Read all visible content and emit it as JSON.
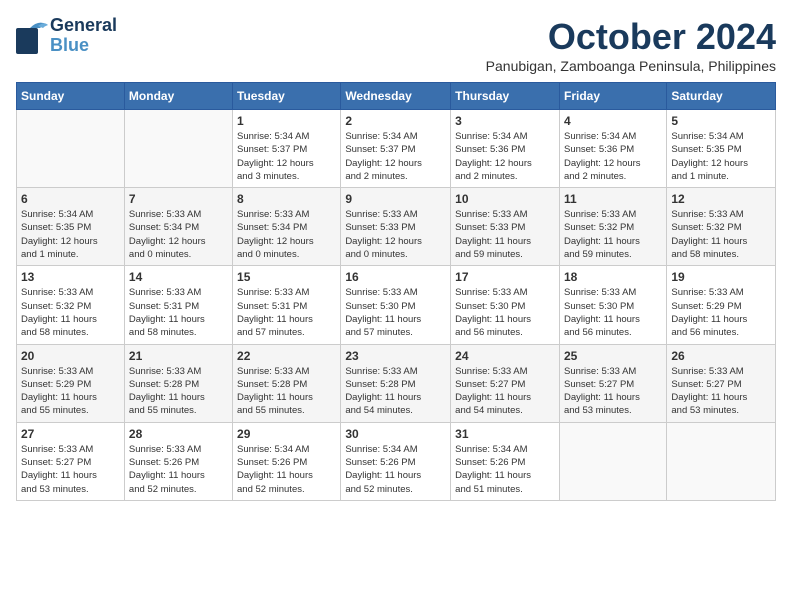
{
  "logo": {
    "general": "General",
    "blue": "Blue"
  },
  "title": "October 2024",
  "location": "Panubigan, Zamboanga Peninsula, Philippines",
  "days_header": [
    "Sunday",
    "Monday",
    "Tuesday",
    "Wednesday",
    "Thursday",
    "Friday",
    "Saturday"
  ],
  "weeks": [
    [
      {
        "day": "",
        "info": ""
      },
      {
        "day": "",
        "info": ""
      },
      {
        "day": "1",
        "info": "Sunrise: 5:34 AM\nSunset: 5:37 PM\nDaylight: 12 hours\nand 3 minutes."
      },
      {
        "day": "2",
        "info": "Sunrise: 5:34 AM\nSunset: 5:37 PM\nDaylight: 12 hours\nand 2 minutes."
      },
      {
        "day": "3",
        "info": "Sunrise: 5:34 AM\nSunset: 5:36 PM\nDaylight: 12 hours\nand 2 minutes."
      },
      {
        "day": "4",
        "info": "Sunrise: 5:34 AM\nSunset: 5:36 PM\nDaylight: 12 hours\nand 2 minutes."
      },
      {
        "day": "5",
        "info": "Sunrise: 5:34 AM\nSunset: 5:35 PM\nDaylight: 12 hours\nand 1 minute."
      }
    ],
    [
      {
        "day": "6",
        "info": "Sunrise: 5:34 AM\nSunset: 5:35 PM\nDaylight: 12 hours\nand 1 minute."
      },
      {
        "day": "7",
        "info": "Sunrise: 5:33 AM\nSunset: 5:34 PM\nDaylight: 12 hours\nand 0 minutes."
      },
      {
        "day": "8",
        "info": "Sunrise: 5:33 AM\nSunset: 5:34 PM\nDaylight: 12 hours\nand 0 minutes."
      },
      {
        "day": "9",
        "info": "Sunrise: 5:33 AM\nSunset: 5:33 PM\nDaylight: 12 hours\nand 0 minutes."
      },
      {
        "day": "10",
        "info": "Sunrise: 5:33 AM\nSunset: 5:33 PM\nDaylight: 11 hours\nand 59 minutes."
      },
      {
        "day": "11",
        "info": "Sunrise: 5:33 AM\nSunset: 5:32 PM\nDaylight: 11 hours\nand 59 minutes."
      },
      {
        "day": "12",
        "info": "Sunrise: 5:33 AM\nSunset: 5:32 PM\nDaylight: 11 hours\nand 58 minutes."
      }
    ],
    [
      {
        "day": "13",
        "info": "Sunrise: 5:33 AM\nSunset: 5:32 PM\nDaylight: 11 hours\nand 58 minutes."
      },
      {
        "day": "14",
        "info": "Sunrise: 5:33 AM\nSunset: 5:31 PM\nDaylight: 11 hours\nand 58 minutes."
      },
      {
        "day": "15",
        "info": "Sunrise: 5:33 AM\nSunset: 5:31 PM\nDaylight: 11 hours\nand 57 minutes."
      },
      {
        "day": "16",
        "info": "Sunrise: 5:33 AM\nSunset: 5:30 PM\nDaylight: 11 hours\nand 57 minutes."
      },
      {
        "day": "17",
        "info": "Sunrise: 5:33 AM\nSunset: 5:30 PM\nDaylight: 11 hours\nand 56 minutes."
      },
      {
        "day": "18",
        "info": "Sunrise: 5:33 AM\nSunset: 5:30 PM\nDaylight: 11 hours\nand 56 minutes."
      },
      {
        "day": "19",
        "info": "Sunrise: 5:33 AM\nSunset: 5:29 PM\nDaylight: 11 hours\nand 56 minutes."
      }
    ],
    [
      {
        "day": "20",
        "info": "Sunrise: 5:33 AM\nSunset: 5:29 PM\nDaylight: 11 hours\nand 55 minutes."
      },
      {
        "day": "21",
        "info": "Sunrise: 5:33 AM\nSunset: 5:28 PM\nDaylight: 11 hours\nand 55 minutes."
      },
      {
        "day": "22",
        "info": "Sunrise: 5:33 AM\nSunset: 5:28 PM\nDaylight: 11 hours\nand 55 minutes."
      },
      {
        "day": "23",
        "info": "Sunrise: 5:33 AM\nSunset: 5:28 PM\nDaylight: 11 hours\nand 54 minutes."
      },
      {
        "day": "24",
        "info": "Sunrise: 5:33 AM\nSunset: 5:27 PM\nDaylight: 11 hours\nand 54 minutes."
      },
      {
        "day": "25",
        "info": "Sunrise: 5:33 AM\nSunset: 5:27 PM\nDaylight: 11 hours\nand 53 minutes."
      },
      {
        "day": "26",
        "info": "Sunrise: 5:33 AM\nSunset: 5:27 PM\nDaylight: 11 hours\nand 53 minutes."
      }
    ],
    [
      {
        "day": "27",
        "info": "Sunrise: 5:33 AM\nSunset: 5:27 PM\nDaylight: 11 hours\nand 53 minutes."
      },
      {
        "day": "28",
        "info": "Sunrise: 5:33 AM\nSunset: 5:26 PM\nDaylight: 11 hours\nand 52 minutes."
      },
      {
        "day": "29",
        "info": "Sunrise: 5:34 AM\nSunset: 5:26 PM\nDaylight: 11 hours\nand 52 minutes."
      },
      {
        "day": "30",
        "info": "Sunrise: 5:34 AM\nSunset: 5:26 PM\nDaylight: 11 hours\nand 52 minutes."
      },
      {
        "day": "31",
        "info": "Sunrise: 5:34 AM\nSunset: 5:26 PM\nDaylight: 11 hours\nand 51 minutes."
      },
      {
        "day": "",
        "info": ""
      },
      {
        "day": "",
        "info": ""
      }
    ]
  ]
}
